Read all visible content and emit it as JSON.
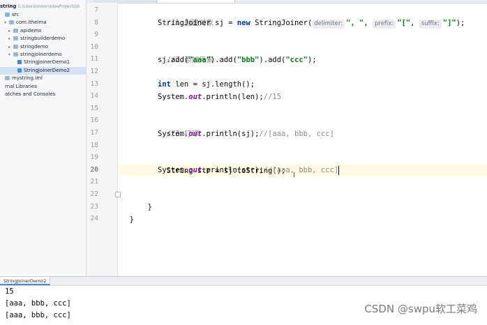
{
  "project_tree": {
    "root_label": "string",
    "root_path": "C:\\Users\\moon\\IdeaProjects\\b",
    "items": [
      {
        "label": "src",
        "depth": 0,
        "icon": "folder-icon",
        "arrow": "",
        "selected": false
      },
      {
        "label": "com.itheima",
        "depth": 1,
        "icon": "package-icon",
        "arrow": "▾",
        "selected": false
      },
      {
        "label": "apidemo",
        "depth": 2,
        "icon": "package-icon",
        "arrow": "▸",
        "selected": false
      },
      {
        "label": "stringbuilderdemo",
        "depth": 2,
        "icon": "package-icon",
        "arrow": "▸",
        "selected": false
      },
      {
        "label": "stringdemo",
        "depth": 2,
        "icon": "package-icon",
        "arrow": "▸",
        "selected": false
      },
      {
        "label": "stringjoinerdemo",
        "depth": 2,
        "icon": "package-icon",
        "arrow": "▾",
        "selected": false
      },
      {
        "label": "StringJoinerDemo1",
        "depth": 3,
        "icon": "class-icon",
        "arrow": "",
        "selected": false
      },
      {
        "label": "StringJoinerDemo2",
        "depth": 3,
        "icon": "class-icon",
        "arrow": "",
        "selected": true
      },
      {
        "label": "mystring.iml",
        "depth": 0,
        "icon": "iml-file-icon",
        "arrow": "",
        "selected": false
      },
      {
        "label": "rnal Libraries",
        "depth": 0,
        "icon": "",
        "arrow": "",
        "selected": false
      },
      {
        "label": "atches and Consoles",
        "depth": 0,
        "icon": "",
        "arrow": "",
        "selected": false
      }
    ]
  },
  "editor": {
    "line_numbers": [
      "7",
      "8",
      "9",
      "10",
      "11",
      "12",
      "13",
      "14",
      "15",
      "16",
      "17",
      "18",
      "19",
      "20",
      "21",
      "22",
      "23",
      "24"
    ],
    "current_line": "20",
    "lines": {
      "l7_comment": "//1.创建对象",
      "l8_a": "StringJoiner sj = ",
      "l8_new": "new",
      "l8_b": " StringJoiner(",
      "l8_hint_delimiter": "delimiter:",
      "l8_s1": "\", \"",
      "l8_sep1": ", ",
      "l8_hint_prefix": "prefix:",
      "l8_s2": "\"[\"",
      "l8_sep2": ", ",
      "l8_hint_suffix": "suffix:",
      "l8_s3": "\"]\"",
      "l8_end": ");",
      "l10_comment": "//2.添加元素",
      "l11_a": "sj.add(",
      "l11_s1": "\"aaa\"",
      "l11_b": ").add(",
      "l11_s2": "\"bbb\"",
      "l11_c": ").add(",
      "l11_s3": "\"ccc\"",
      "l11_end": ");",
      "l13_int": "int",
      "l13_rest": " len = sj.length();",
      "l14_a": "System.",
      "l14_out": "out",
      "l14_b": ".println(len);",
      "l14_comment": "//15",
      "l16_comment": "//3.打印",
      "l17_a": "System.",
      "l17_out": "out",
      "l17_b": ".println(sj);",
      "l17_comment": "//[aaa, bbb, ccc]",
      "l19_a": "String str = sj.toString();",
      "l20_a": "System.",
      "l20_out": "out",
      "l20_b": ".println(str);",
      "l20_comment": "//[aaa, bbb, ccc]",
      "l22": "}",
      "l23": "}"
    }
  },
  "run_panel": {
    "tab_label": "StringJoinerDemo2",
    "output": [
      "15",
      "[aaa, bbb, ccc]",
      "[aaa, bbb, ccc]"
    ]
  },
  "watermark": "CSDN @swpu软工菜鸡",
  "colors": {
    "keyword": "#0033b3",
    "string": "#067d17",
    "comment": "#8c8c8c",
    "static_field": "#871094",
    "current_line_bg": "#fffae3",
    "selection_bg": "#d5e1f5"
  }
}
